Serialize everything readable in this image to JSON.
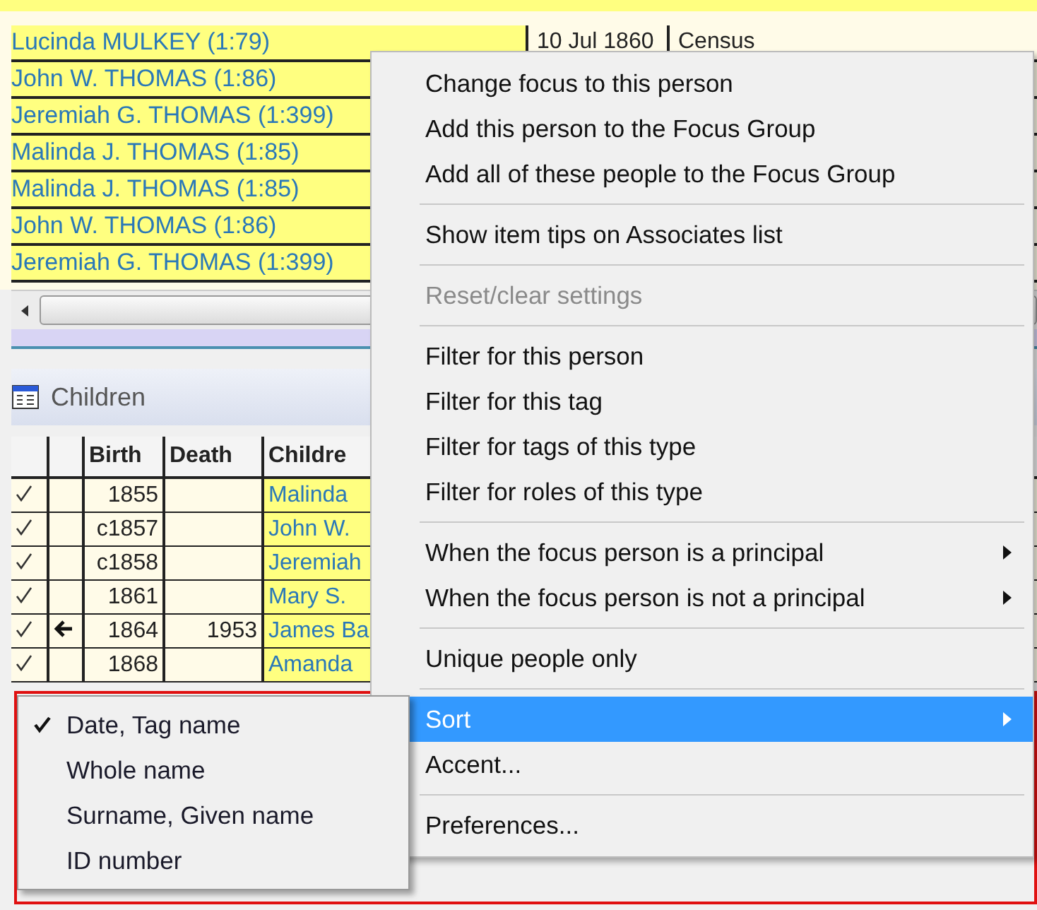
{
  "associates": [
    {
      "name": "Lucinda MULKEY (1:79)",
      "date": "10 Jul 1860",
      "event": "Census"
    },
    {
      "name": "John W. THOMAS (1:86)"
    },
    {
      "name": "Jeremiah G. THOMAS (1:399)"
    },
    {
      "name": "Malinda J. THOMAS (1:85)"
    },
    {
      "name": "Malinda J. THOMAS (1:85)"
    },
    {
      "name": "John W. THOMAS (1:86)"
    },
    {
      "name": "Jeremiah G. THOMAS (1:399)"
    }
  ],
  "children_panel": {
    "title": "Children",
    "columns": [
      "Birth",
      "Death",
      "Childre"
    ],
    "rows": [
      {
        "checked": true,
        "current": false,
        "birth": "1855",
        "death": "",
        "child": "Malinda"
      },
      {
        "checked": true,
        "current": false,
        "birth": "c1857",
        "death": "",
        "child": "John W."
      },
      {
        "checked": true,
        "current": false,
        "birth": "c1858",
        "death": "",
        "child": "Jeremiah"
      },
      {
        "checked": true,
        "current": false,
        "birth": "1861",
        "death": "",
        "child": "Mary S."
      },
      {
        "checked": true,
        "current": true,
        "birth": "1864",
        "death": "1953",
        "child": "James Ba"
      },
      {
        "checked": true,
        "current": false,
        "birth": "1868",
        "death": "",
        "child": "Amanda"
      }
    ]
  },
  "context_menu": {
    "groups": [
      [
        {
          "label": "Change focus to this person",
          "kind": "item",
          "disabled": false,
          "highlighted": false
        },
        {
          "label": "Add this person to the Focus Group",
          "kind": "item",
          "disabled": false,
          "highlighted": false
        },
        {
          "label": "Add all of these people to the Focus Group",
          "kind": "item",
          "disabled": false,
          "highlighted": false
        }
      ],
      [
        {
          "label": "Show item tips on Associates list",
          "kind": "item",
          "disabled": false,
          "highlighted": false
        }
      ],
      [
        {
          "label": "Reset/clear settings",
          "kind": "item",
          "disabled": true,
          "highlighted": false
        }
      ],
      [
        {
          "label": "Filter for this person",
          "kind": "item",
          "disabled": false,
          "highlighted": false
        },
        {
          "label": "Filter for this tag",
          "kind": "item",
          "disabled": false,
          "highlighted": false
        },
        {
          "label": "Filter for tags of this type",
          "kind": "item",
          "disabled": false,
          "highlighted": false
        },
        {
          "label": "Filter for roles of this type",
          "kind": "item",
          "disabled": false,
          "highlighted": false
        }
      ],
      [
        {
          "label": "When the focus person is a principal",
          "kind": "submenu",
          "disabled": false,
          "highlighted": false
        },
        {
          "label": "When the focus person is not a principal",
          "kind": "submenu",
          "disabled": false,
          "highlighted": false
        }
      ],
      [
        {
          "label": "Unique people only",
          "kind": "item",
          "disabled": false,
          "highlighted": false
        }
      ],
      [
        {
          "label": "Sort",
          "kind": "submenu",
          "disabled": false,
          "highlighted": true
        },
        {
          "label": "Accent...",
          "kind": "item",
          "disabled": false,
          "highlighted": false
        }
      ],
      [
        {
          "label": "Preferences...",
          "kind": "item",
          "disabled": false,
          "highlighted": false
        }
      ]
    ]
  },
  "sort_submenu": [
    {
      "label": "Date, Tag name",
      "checked": true
    },
    {
      "label": "Whole name",
      "checked": false
    },
    {
      "label": "Surname, Given name",
      "checked": false
    },
    {
      "label": "ID number",
      "checked": false
    }
  ]
}
